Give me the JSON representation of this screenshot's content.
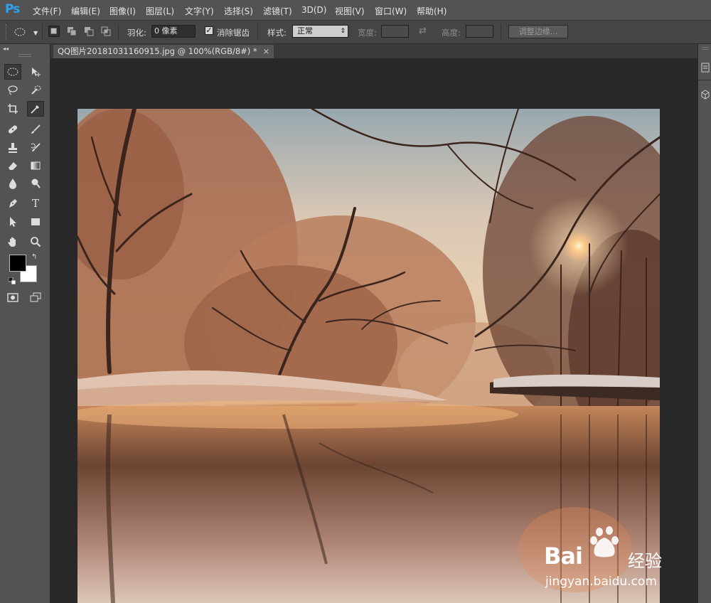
{
  "app": {
    "logo": "Ps"
  },
  "menu": [
    "文件(F)",
    "编辑(E)",
    "图像(I)",
    "图层(L)",
    "文字(Y)",
    "选择(S)",
    "滤镜(T)",
    "3D(D)",
    "视图(V)",
    "窗口(W)",
    "帮助(H)"
  ],
  "options": {
    "feather_label": "羽化:",
    "feather_value": "0 像素",
    "antialias_label": "消除锯齿",
    "antialias_checked": "✓",
    "style_label": "样式:",
    "style_value": "正常",
    "width_label": "宽度:",
    "height_label": "高度:",
    "refine_edge": "调整边缘..."
  },
  "document": {
    "tab_title": "QQ图片20181031160915.jpg @ 100%(RGB/8#) *",
    "close": "×"
  },
  "colors": {
    "foreground": "#000000",
    "background": "#ffffff"
  },
  "watermark": {
    "brand": "Bai",
    "brand_suffix": "经验",
    "url": "jingyan.baidu.com"
  }
}
